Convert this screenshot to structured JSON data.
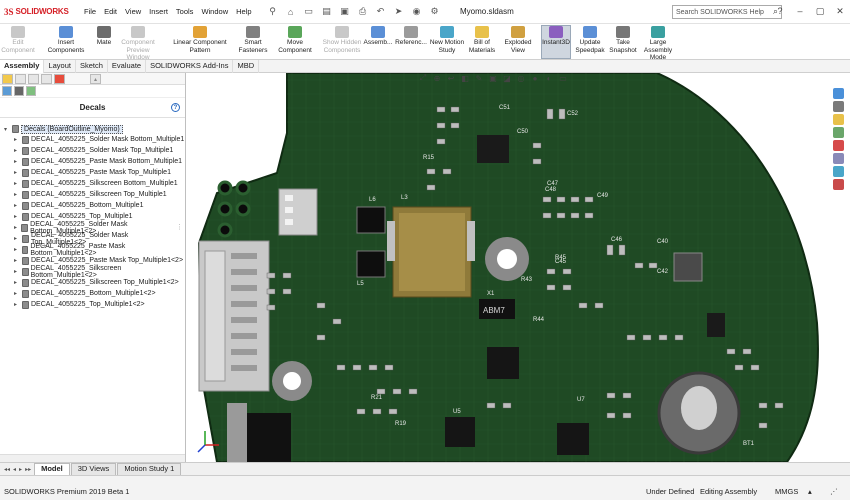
{
  "app": {
    "logo_prefix": "3S",
    "logo_text": "SOLIDWORKS",
    "document_title": "Myomo.sldasm",
    "search_placeholder": "Search SOLIDWORKS Help"
  },
  "menu": [
    "File",
    "Edit",
    "View",
    "Insert",
    "Tools",
    "Window",
    "Help"
  ],
  "ribbon": {
    "items": [
      {
        "label": "Edit\nComponent",
        "dim": true
      },
      {
        "label": "Insert Components",
        "dim": false
      },
      {
        "label": "Mate",
        "dim": false
      },
      {
        "label": "Component\nPreview Window",
        "dim": true
      },
      {
        "label": "Linear Component Pattern",
        "dim": false
      },
      {
        "label": "Smart\nFasteners",
        "dim": false
      },
      {
        "label": "Move Component",
        "dim": false
      },
      {
        "label": "Show Hidden\nComponents",
        "dim": true
      },
      {
        "label": "Assemb...",
        "dim": false
      },
      {
        "label": "Referenc...",
        "dim": false
      },
      {
        "label": "New Motion\nStudy",
        "dim": false
      },
      {
        "label": "Bill of\nMaterials",
        "dim": false
      },
      {
        "label": "Exploded View",
        "dim": false
      },
      {
        "label": "Instant3D",
        "dim": false
      },
      {
        "label": "Update\nSpeedpak",
        "dim": false
      },
      {
        "label": "Take\nSnapshot",
        "dim": false
      },
      {
        "label": "Large Assembly\nMode",
        "dim": false
      }
    ]
  },
  "command_tabs": [
    "Assembly",
    "Layout",
    "Sketch",
    "Evaluate",
    "SOLIDWORKS Add-Ins",
    "MBD"
  ],
  "panel": {
    "header": "Decals",
    "root": "Decals (BoardOutline_Myomo)",
    "items": [
      "DECAL_4055225_Solder Mask Bottom_Multiple1",
      "DECAL_4055225_Solder Mask Top_Multiple1",
      "DECAL_4055225_Paste Mask Bottom_Multiple1",
      "DECAL_4055225_Paste Mask Top_Multiple1",
      "DECAL_4055225_Silkscreen Bottom_Multiple1",
      "DECAL_4055225_Silkscreen Top_Multiple1",
      "DECAL_4055225_Bottom_Multiple1",
      "DECAL_4055225_Top_Multiple1",
      "DECAL_4055225_Solder Mask Bottom_Multiple1<2>",
      "DECAL_4055225_Solder Mask Top_Multiple1<2>",
      "DECAL_4055225_Paste Mask Bottom_Multiple1<2>",
      "DECAL_4055225_Paste Mask Top_Multiple1<2>",
      "DECAL_4055225_Silkscreen Bottom_Multiple1<2>",
      "DECAL_4055225_Silkscreen Top_Multiple1<2>",
      "DECAL_4055225_Bottom_Multiple1<2>",
      "DECAL_4055225_Top_Multiple1<2>"
    ]
  },
  "viewport": {
    "chip_label": "ABM7",
    "silk_labels": [
      "C51",
      "L6",
      "L5",
      "L3",
      "R15",
      "R43",
      "X1",
      "C49",
      "C48",
      "C46",
      "C45",
      "C42",
      "U7",
      "R21",
      "BT1",
      "R19",
      "U5",
      "C52",
      "C50",
      "C47",
      "R44",
      "C40",
      "R45"
    ]
  },
  "bottom_tabs": [
    "Model",
    "3D Views",
    "Motion Study 1"
  ],
  "status": {
    "version": "SOLIDWORKS Premium 2019 Beta 1",
    "state": "Under Defined",
    "mode": "Editing Assembly",
    "units": "MMGS"
  },
  "colors": {
    "pcb_green": "#1f4a24",
    "accent_red": "#d51f26",
    "selection_blue": "#dfe9f7"
  }
}
